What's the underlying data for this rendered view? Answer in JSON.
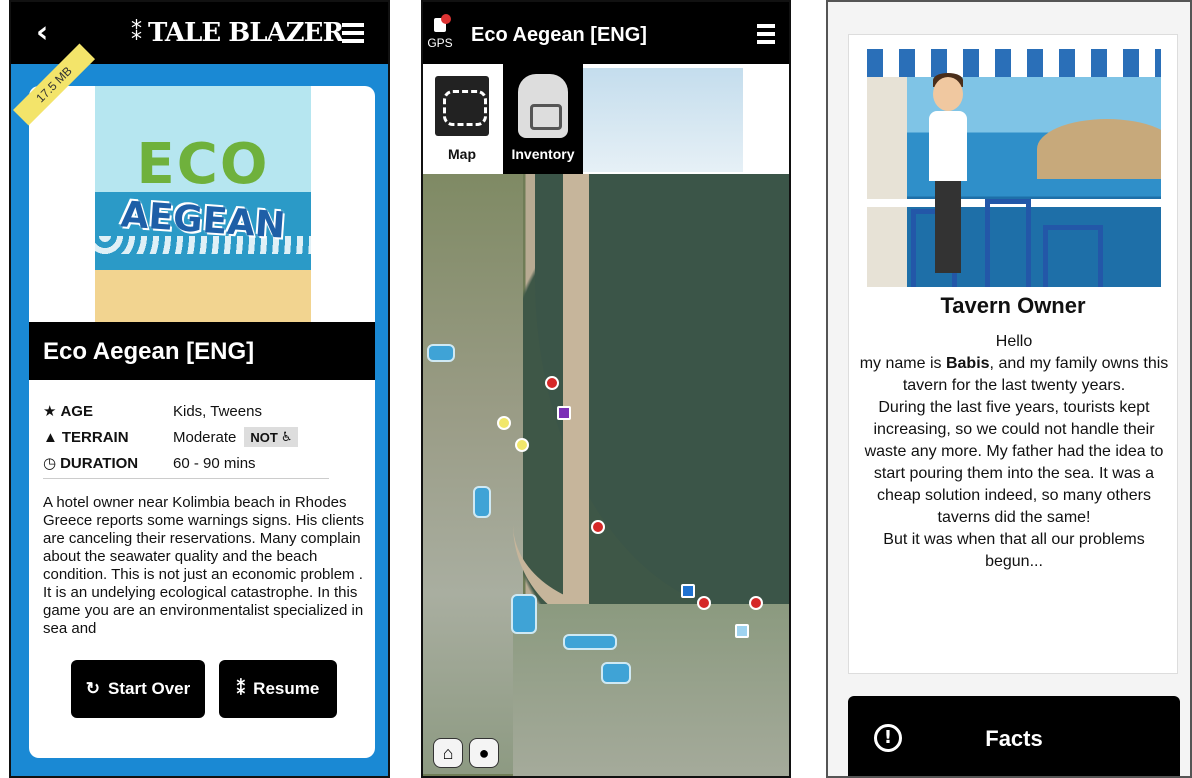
{
  "panel1": {
    "logo_text": "TALE BLAZER",
    "size_tag": "17.5 MB",
    "art_title_top": "ECO",
    "art_title_bottom": "AEGEAN",
    "game_title": "Eco Aegean [ENG]",
    "meta": {
      "age_label": "AGE",
      "age_value": "Kids, Tweens",
      "terrain_label": "TERRAIN",
      "terrain_value": "Moderate",
      "terrain_badge": "NOT",
      "duration_label": "DURATION",
      "duration_value": "60 - 90 mins"
    },
    "description": "A hotel owner near Kolimbia beach in Rhodes Greece reports some warnings signs. His clients are canceling their reservations. Many complain about the seawater quality and the beach condition. This is not just an economic problem . It is an undelying ecological catastrophe. In this game you are an environmentalist specialized in sea and",
    "start_over_label": "Start Over",
    "resume_label": "Resume"
  },
  "panel2": {
    "gps_label": "GPS",
    "title": "Eco Aegean [ENG]",
    "tabs": [
      {
        "label": "Map"
      },
      {
        "label": "Inventory"
      }
    ]
  },
  "panel3": {
    "character_name": "Tavern Owner",
    "dialog_intro": "Hello",
    "dialog_before_name": "my name is ",
    "dialog_name": "Babis",
    "dialog_after_name": ", and my family owns this tavern for the last twenty years.",
    "dialog_rest": "During the last five years, tourists kept increasing, so we could not handle their waste any more. My father had the idea to start pouring them into the sea. It was a cheap solution indeed, so many others taverns did the same!",
    "dialog_end": "But it was when that all our problems begun...",
    "facts_label": "Facts"
  },
  "colors": {
    "panel1_bg": "#1a89d4",
    "bar_black": "#000000",
    "marker_red": "#d52828",
    "marker_yellow": "#f1e76a",
    "marker_purple": "#7b2fb6",
    "marker_blue": "#1f72d1"
  },
  "icons": {
    "back": "chevron-left-icon",
    "menu": "hamburger-menu-icon",
    "star": "star-icon",
    "terrain": "mountain-icon",
    "clock": "clock-icon",
    "wheelchair": "wheelchair-icon",
    "refresh": "refresh-icon",
    "footsteps": "footsteps-icon",
    "map": "map-icon",
    "backpack": "backpack-icon",
    "home": "home-icon",
    "person": "person-icon",
    "info": "exclamation-circle-icon"
  }
}
